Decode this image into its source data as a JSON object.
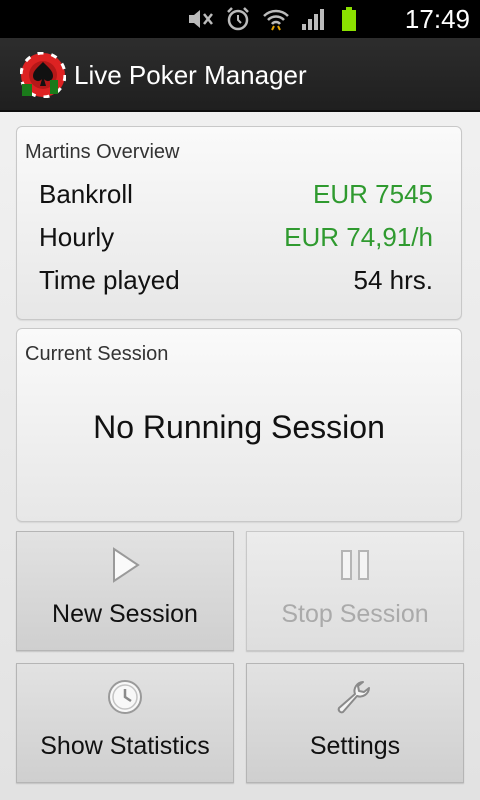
{
  "status_bar": {
    "time": "17:49",
    "icons": [
      "mute-icon",
      "alarm-icon",
      "wifi-icon",
      "signal-icon",
      "battery-icon"
    ]
  },
  "app_bar": {
    "title": "Live Poker Manager",
    "logo_icon": "poker-chip-logo"
  },
  "overview": {
    "title": "Martins Overview",
    "rows": [
      {
        "label": "Bankroll",
        "value": "EUR 7545",
        "color": "#2f9a2f"
      },
      {
        "label": "Hourly",
        "value": "EUR 74,91/h",
        "color": "#2f9a2f"
      },
      {
        "label": "Time played",
        "value": "54 hrs.",
        "color": "#111111"
      }
    ]
  },
  "session": {
    "title": "Current Session",
    "status": "No Running Session"
  },
  "buttons": {
    "new_session": {
      "label": "New Session",
      "icon": "play-icon",
      "enabled": true
    },
    "stop_session": {
      "label": "Stop Session",
      "icon": "pause-icon",
      "enabled": false
    },
    "show_statistics": {
      "label": "Show Statistics",
      "icon": "clock-icon",
      "enabled": true
    },
    "settings": {
      "label": "Settings",
      "icon": "wrench-icon",
      "enabled": true
    }
  }
}
